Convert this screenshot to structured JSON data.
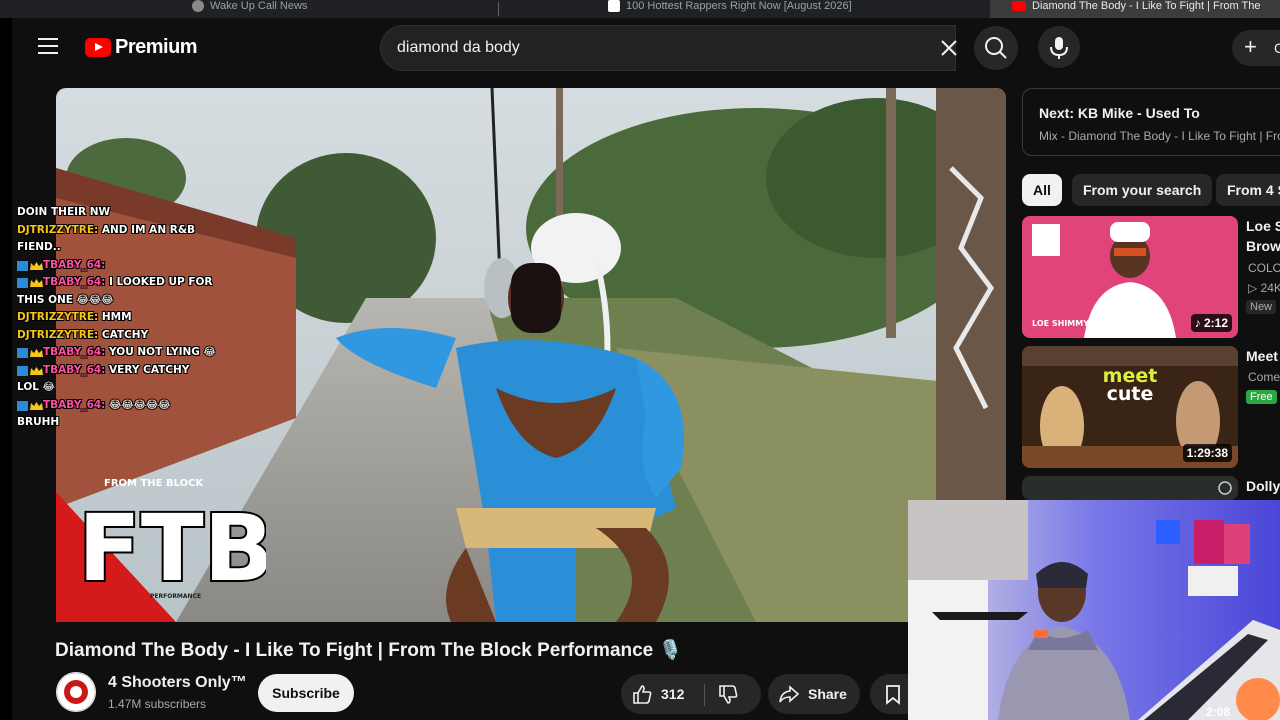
{
  "browser": {
    "tabs": [
      {
        "title": "Wake Up Call News",
        "active": false
      },
      {
        "title": "100 Hottest Rappers Right Now [August 2026]",
        "active": false
      },
      {
        "title": "Diamond The Body - I Like To Fight | From The",
        "active": true
      }
    ]
  },
  "header": {
    "logo_text": "Premium",
    "search_value": "diamond da body",
    "create_label": "C"
  },
  "chat": [
    {
      "user": "",
      "text": "DOIN THEIR NW",
      "user_color": "yellow",
      "badges": false
    },
    {
      "user": "DJTRIZZYTRE:",
      "text": "AND IM AN R&B FIEND..",
      "user_color": "yellow",
      "badges": false
    },
    {
      "user": "TBABY_64:",
      "text": "",
      "user_color": "pink",
      "badges": true
    },
    {
      "user": "TBABY_64:",
      "text": "I LOOKED UP FOR THIS ONE 😂😂😂",
      "user_color": "pink",
      "badges": true
    },
    {
      "user": "DJTRIZZYTRE:",
      "text": "HMM",
      "user_color": "yellow",
      "badges": false
    },
    {
      "user": "DJTRIZZYTRE:",
      "text": "CATCHY",
      "user_color": "yellow",
      "badges": false
    },
    {
      "user": "TBABY_64:",
      "text": "YOU NOT LYING 😂",
      "user_color": "pink",
      "badges": true
    },
    {
      "user": "TBABY_64:",
      "text": "VERY CATCHY",
      "user_color": "pink",
      "badges": true
    },
    {
      "user": "",
      "text": "LOL 😂",
      "user_color": "yellow",
      "badges": false
    },
    {
      "user": "TBABY_64:",
      "text": "😂😂😂😂😂",
      "user_color": "pink",
      "badges": true
    },
    {
      "user": "",
      "text": "BRUHH",
      "user_color": "yellow",
      "badges": false
    }
  ],
  "overlay_logo": {
    "top_text": "FROM THE BLOCK",
    "main_text": "FTB",
    "bottom_text": "PERFORMANCE"
  },
  "video": {
    "title": "Diamond The Body - I Like To Fight | From The Block Performance 🎙️",
    "channel": "4 Shooters Only™",
    "subscribers": "1.47M subscribers",
    "subscribe_label": "Subscribe",
    "likes": "312",
    "share_label": "Share"
  },
  "sidebar": {
    "next_label": "Next:",
    "next_title": "KB Mike - Used To",
    "next_sub": "Mix - Diamond The Body - I Like To Fight | Fro",
    "chips": [
      "All",
      "From your search",
      "From 4 S"
    ],
    "recs": [
      {
        "title_partial": "Loe S",
        "title_line2": "Brow",
        "meta1": "COLO",
        "meta2": "▷ 24K",
        "badge": "New",
        "duration": "♪ 2:12",
        "thumb_text": "LOE SHIMMY"
      },
      {
        "title_partial": "Meet",
        "meta1": "Come",
        "badge": "Free",
        "duration": "1:29:38",
        "thumb_text_1": "meet",
        "thumb_text_2": "cute"
      },
      {
        "title_partial": "Dolly"
      }
    ]
  },
  "webcam": {
    "time": "2:08"
  },
  "colors": {
    "background": "#0f0f0f",
    "brand_red": "#ff0000",
    "chat_yellow": "#f5c518",
    "chat_pink": "#ff4fa3",
    "free_badge": "#2ba640"
  }
}
